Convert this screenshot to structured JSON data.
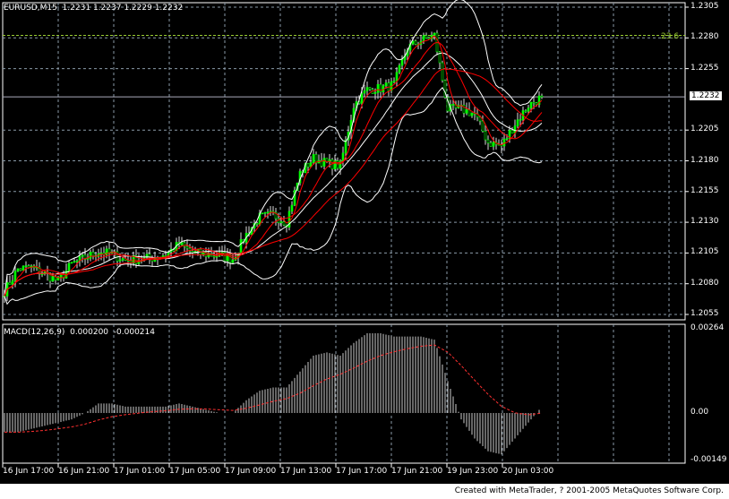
{
  "header": {
    "symbol": "EURUSD,M15",
    "open": "1.2231",
    "high": "1.2237",
    "low": "1.2229",
    "close": "1.2232"
  },
  "macd_header": {
    "name": "MACD(12,26,9)",
    "main": "0.000200",
    "signal": "-0.000214"
  },
  "current_price": "1.2232",
  "fibo_label": "23.6",
  "credit": "Created with MetaTrader, ? 2001-2005 MetaQuotes Software Corp.",
  "colors": {
    "background": "#000000",
    "grid": "#8a9aa8",
    "candle_up": "#00ff00",
    "bands": "#ffffff",
    "moving_averages": "#ff0000",
    "fibo": "#9acd32"
  },
  "chart_data": [
    {
      "type": "candlestick",
      "title": "EURUSD,M15",
      "y_ticks": [
        "1.2305",
        "1.2280",
        "1.2255",
        "1.2205",
        "1.2180",
        "1.2155",
        "1.2130",
        "1.2105",
        "1.2080",
        "1.2055"
      ],
      "ylim": [
        1.2052,
        1.231
      ],
      "x_ticks": [
        "16 Jun 17:00",
        "16 Jun 21:00",
        "17 Jun 01:00",
        "17 Jun 05:00",
        "17 Jun 09:00",
        "17 Jun 13:00",
        "17 Jun 17:00",
        "17 Jun 21:00",
        "19 Jun 23:00",
        "20 Jun 03:00"
      ],
      "fibo_level": 1.2282,
      "close": [
        1.2074,
        1.2092,
        1.2093,
        1.2088,
        1.2082,
        1.2096,
        1.2101,
        1.2106,
        1.2104,
        1.2099,
        1.21,
        1.2101,
        1.2104,
        1.2112,
        1.2105,
        1.2104,
        1.2103,
        1.21,
        1.212,
        1.2134,
        1.2136,
        1.213,
        1.217,
        1.2182,
        1.2178,
        1.2176,
        1.2225,
        1.2238,
        1.2239,
        1.2242,
        1.2272,
        1.2278,
        1.2282,
        1.2222,
        1.2222,
        1.2218,
        1.2195,
        1.2192,
        1.221,
        1.2225,
        1.2232
      ]
    },
    {
      "type": "bar",
      "title": "MACD(12,26,9)",
      "y_ticks": [
        "0.00264",
        "0.00",
        "-0.00149"
      ],
      "ylim": [
        -0.00149,
        0.00264
      ],
      "histogram": [
        -0.0006,
        -0.0006,
        -0.0005,
        -0.0004,
        -0.0003,
        -0.0002,
        0.0,
        0.0003,
        0.0003,
        0.0002,
        0.0002,
        0.0002,
        0.0002,
        0.0003,
        0.0002,
        0.0001,
        0.0,
        0.0,
        0.0004,
        0.0007,
        0.0008,
        0.0008,
        0.0013,
        0.0018,
        0.0019,
        0.0018,
        0.0022,
        0.0025,
        0.0025,
        0.0024,
        0.0024,
        0.0024,
        0.0023,
        0.001,
        -0.0002,
        -0.0008,
        -0.0012,
        -0.0013,
        -0.0008,
        -0.0003,
        0.0002
      ]
    }
  ]
}
